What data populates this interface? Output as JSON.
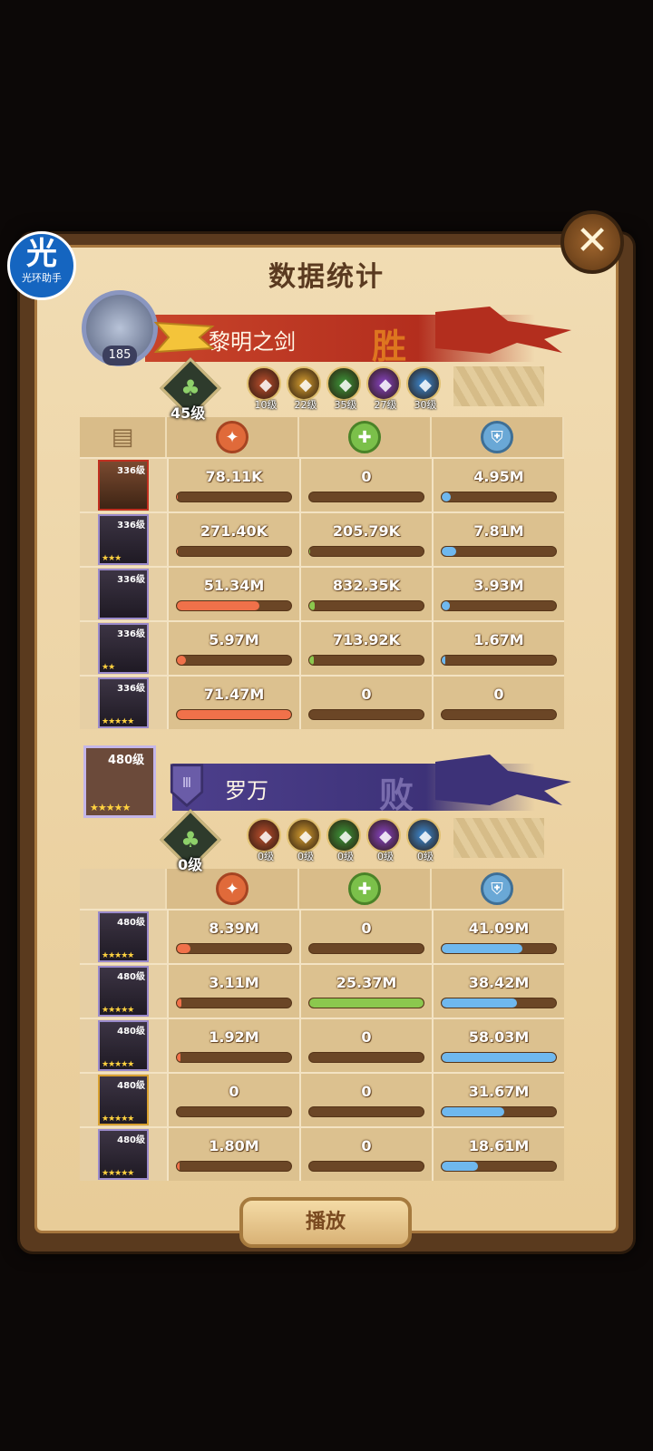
{
  "app_badge": {
    "big": "光",
    "small": "光环助手"
  },
  "close_glyph": "✕",
  "title": "数据统计",
  "team1": {
    "player_level": "185",
    "name": "黎明之剑",
    "result": "胜",
    "tree_level": "45级",
    "factions": [
      {
        "icon": "lightbearer-icon",
        "level": "10级",
        "color": "#c0502e"
      },
      {
        "icon": "maulers-icon",
        "level": "22级",
        "color": "#d8a030"
      },
      {
        "icon": "wilder-icon",
        "level": "35级",
        "color": "#3d9a3a"
      },
      {
        "icon": "graveborn-icon",
        "level": "27级",
        "color": "#8a44c6"
      },
      {
        "icon": "celestial-icon",
        "level": "30级",
        "color": "#3d8cd6"
      }
    ],
    "heroes": [
      {
        "level": "336级",
        "stars": "",
        "frame": "red",
        "damage": "78.11K",
        "heal": "0",
        "shield": "4.95M",
        "dmg_pct": 0.01,
        "heal_pct": 0,
        "shield_pct": 0.08
      },
      {
        "level": "336级",
        "stars": "★★★",
        "frame": "blue",
        "damage": "271.40K",
        "heal": "205.79K",
        "shield": "7.81M",
        "dmg_pct": 0.01,
        "heal_pct": 0.01,
        "shield_pct": 0.13
      },
      {
        "level": "336级",
        "stars": "",
        "frame": "blue",
        "damage": "51.34M",
        "heal": "832.35K",
        "shield": "3.93M",
        "dmg_pct": 0.72,
        "heal_pct": 0.05,
        "shield_pct": 0.07
      },
      {
        "level": "336级",
        "stars": "★★",
        "frame": "blue",
        "damage": "5.97M",
        "heal": "713.92K",
        "shield": "1.67M",
        "dmg_pct": 0.08,
        "heal_pct": 0.04,
        "shield_pct": 0.03
      },
      {
        "level": "336级",
        "stars": "★★★★★",
        "frame": "blue",
        "damage": "71.47M",
        "heal": "0",
        "shield": "0",
        "dmg_pct": 1.0,
        "heal_pct": 0,
        "shield_pct": 0
      }
    ]
  },
  "team2": {
    "player_level": "480级",
    "player_stars": "★★★★★",
    "name": "罗万",
    "result": "败",
    "tree_level": "0级",
    "factions": [
      {
        "icon": "lightbearer-icon",
        "level": "0级",
        "color": "#c0502e"
      },
      {
        "icon": "maulers-icon",
        "level": "0级",
        "color": "#d8a030"
      },
      {
        "icon": "wilder-icon",
        "level": "0级",
        "color": "#3d9a3a"
      },
      {
        "icon": "graveborn-icon",
        "level": "0级",
        "color": "#8a44c6"
      },
      {
        "icon": "celestial-icon",
        "level": "0级",
        "color": "#3d8cd6"
      }
    ],
    "heroes": [
      {
        "level": "480级",
        "stars": "★★★★★",
        "frame": "blue",
        "damage": "8.39M",
        "heal": "0",
        "shield": "41.09M",
        "dmg_pct": 0.12,
        "heal_pct": 0,
        "shield_pct": 0.71
      },
      {
        "level": "480级",
        "stars": "★★★★★",
        "frame": "blue",
        "damage": "3.11M",
        "heal": "25.37M",
        "shield": "38.42M",
        "dmg_pct": 0.04,
        "heal_pct": 1.0,
        "shield_pct": 0.66
      },
      {
        "level": "480级",
        "stars": "★★★★★",
        "frame": "blue",
        "damage": "1.92M",
        "heal": "0",
        "shield": "58.03M",
        "dmg_pct": 0.03,
        "heal_pct": 0,
        "shield_pct": 1.0
      },
      {
        "level": "480级",
        "stars": "★★★★★",
        "frame": "gold",
        "damage": "0",
        "heal": "0",
        "shield": "31.67M",
        "dmg_pct": 0,
        "heal_pct": 0,
        "shield_pct": 0.55
      },
      {
        "level": "480级",
        "stars": "★★★★★",
        "frame": "blue",
        "damage": "1.80M",
        "heal": "0",
        "shield": "18.61M",
        "dmg_pct": 0.02,
        "heal_pct": 0,
        "shield_pct": 0.32
      }
    ]
  },
  "column_icons": [
    "damage-icon",
    "healing-icon",
    "shield-icon"
  ],
  "play_label": "播放"
}
